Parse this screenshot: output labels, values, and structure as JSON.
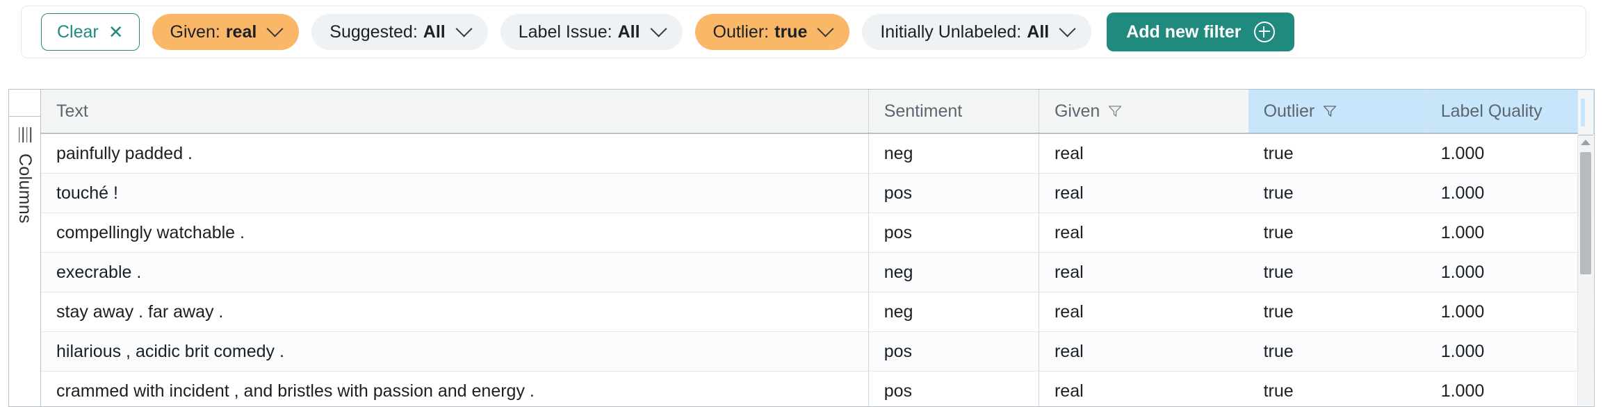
{
  "filter_bar": {
    "clear_button": {
      "label": "Clear",
      "icon": "close-icon",
      "glyph": "✕"
    },
    "filters": [
      {
        "name": "given",
        "label": "Given:",
        "value": "real",
        "active": true,
        "icon": "chevron-down-icon"
      },
      {
        "name": "suggested",
        "label": "Suggested:",
        "value": "All",
        "active": false,
        "icon": "chevron-down-icon"
      },
      {
        "name": "label-issue",
        "label": "Label Issue:",
        "value": "All",
        "active": false,
        "icon": "chevron-down-icon"
      },
      {
        "name": "outlier",
        "label": "Outlier:",
        "value": "true",
        "active": true,
        "icon": "chevron-down-icon"
      },
      {
        "name": "initially-unlabeled",
        "label": "Initially Unlabeled:",
        "value": "All",
        "active": false,
        "icon": "chevron-down-icon"
      }
    ],
    "add_filter_button": {
      "label": "Add new filter",
      "icon": "plus-circle-icon"
    }
  },
  "columns_rail": {
    "label": "Columns",
    "icon": "hamburger-menu-icon"
  },
  "table": {
    "columns": [
      {
        "key": "text",
        "label": "Text",
        "filtered": false,
        "highlighted": false
      },
      {
        "key": "sent",
        "label": "Sentiment",
        "filtered": false,
        "highlighted": false
      },
      {
        "key": "given",
        "label": "Given",
        "filtered": true,
        "highlighted": false
      },
      {
        "key": "outlier",
        "label": "Outlier",
        "filtered": true,
        "highlighted": true
      },
      {
        "key": "quality",
        "label": "Label Quality",
        "filtered": false,
        "highlighted": true
      }
    ],
    "rows": [
      {
        "text": "painfully padded .",
        "sent": "neg",
        "given": "real",
        "outlier": "true",
        "quality": "1.000"
      },
      {
        "text": "touché !",
        "sent": "pos",
        "given": "real",
        "outlier": "true",
        "quality": "1.000"
      },
      {
        "text": "compellingly watchable .",
        "sent": "pos",
        "given": "real",
        "outlier": "true",
        "quality": "1.000"
      },
      {
        "text": "execrable .",
        "sent": "neg",
        "given": "real",
        "outlier": "true",
        "quality": "1.000"
      },
      {
        "text": "stay away . far away .",
        "sent": "neg",
        "given": "real",
        "outlier": "true",
        "quality": "1.000"
      },
      {
        "text": "hilarious , acidic brit comedy .",
        "sent": "pos",
        "given": "real",
        "outlier": "true",
        "quality": "1.000"
      },
      {
        "text": "crammed with incident , and bristles with passion and energy .",
        "sent": "pos",
        "given": "real",
        "outlier": "true",
        "quality": "1.000"
      }
    ]
  },
  "scrollbar": {
    "name": "vertical-scrollbar",
    "orientation": "vertical"
  },
  "colors": {
    "accent_teal": "#1f8a7d",
    "filter_active_orange": "#f9b767",
    "filter_idle_grey": "#eef2f5",
    "header_highlight_blue": "#c8e6fb",
    "row_alt": "#fafcfe"
  }
}
